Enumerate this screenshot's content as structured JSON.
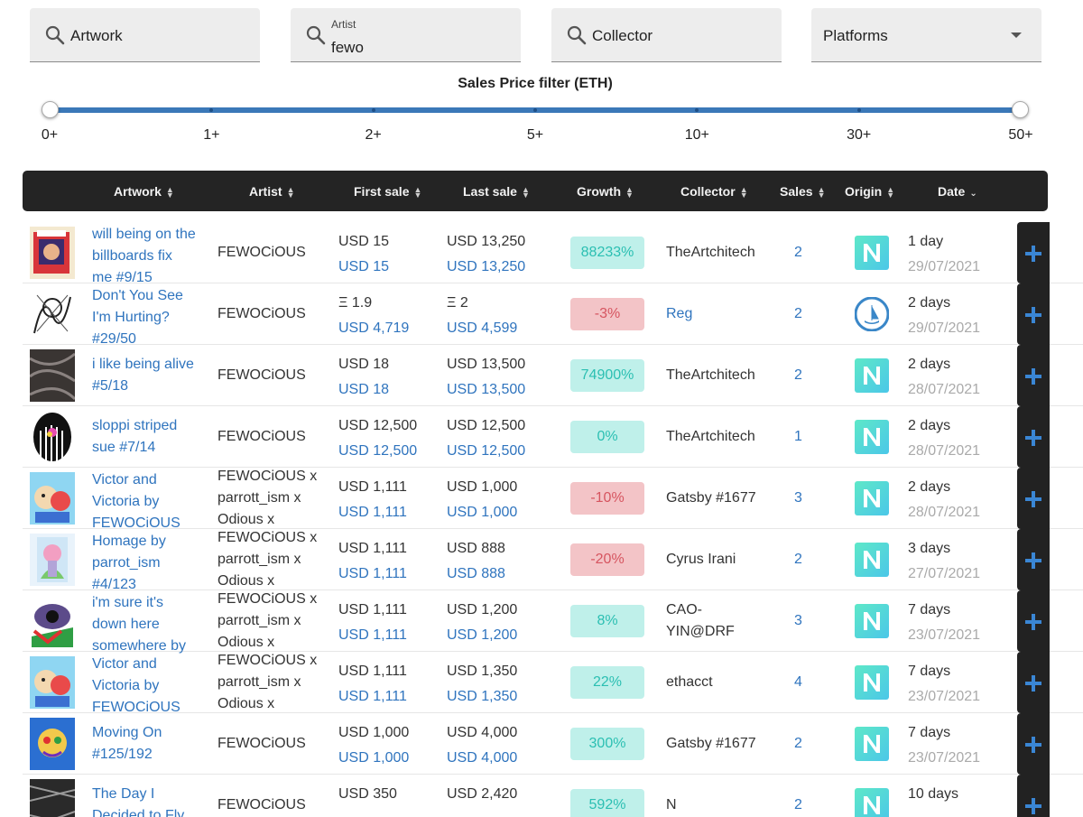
{
  "filters": {
    "artwork_placeholder": "Artwork",
    "artist_label": "Artist",
    "artist_value": "fewo",
    "collector_placeholder": "Collector",
    "platforms_placeholder": "Platforms"
  },
  "slider": {
    "title": "Sales Price filter (ETH)",
    "ticks": [
      "0+",
      "1+",
      "2+",
      "5+",
      "10+",
      "30+",
      "50+"
    ],
    "selected_min": "0+",
    "selected_max": "50+"
  },
  "columns": [
    "Artwork",
    "Artist",
    "First sale",
    "Last sale",
    "Growth",
    "Collector",
    "Sales",
    "Origin",
    "Date"
  ],
  "colors": {
    "accent": "#2f74be",
    "header_bg": "#242424",
    "growth_pos_bg": "#bff0ea",
    "growth_pos_text": "#2bbfb2",
    "growth_neg_bg": "#f3c4c7",
    "growth_neg_text": "#d65560",
    "nifty_origin": "#4fe0cc",
    "opensea_origin": "#2f74be"
  },
  "rows": [
    {
      "title": [
        "will being on the",
        "billboards fix",
        "me #9/15"
      ],
      "artist": [
        "FEWOCiOUS"
      ],
      "first_a": "USD 15",
      "first_b": "USD 15",
      "last_a": "USD 13,250",
      "last_b": "USD 13,250",
      "growth": "88233%",
      "growth_sign": "pos",
      "collector": "TheArtchitech",
      "collector_link": false,
      "sales": "2",
      "origin": "N",
      "origin_icon": "nifty-gateway-icon",
      "date_rel": "1 day",
      "date_abs": "29/07/2021"
    },
    {
      "title": [
        "Don't You See",
        "I'm Hurting?",
        "#29/50"
      ],
      "artist": [
        "FEWOCiOUS"
      ],
      "first_a": "Ξ 1.9",
      "first_b": "USD 4,719",
      "last_a": "Ξ 2",
      "last_b": "USD 4,599",
      "growth": "-3%",
      "growth_sign": "neg",
      "collector": "Reg",
      "collector_link": true,
      "sales": "2",
      "origin": "",
      "origin_icon": "opensea-icon",
      "date_rel": "2 days",
      "date_abs": "29/07/2021"
    },
    {
      "title": [
        "i like being alive",
        "#5/18"
      ],
      "artist": [
        "FEWOCiOUS"
      ],
      "first_a": "USD 18",
      "first_b": "USD 18",
      "last_a": "USD 13,500",
      "last_b": "USD 13,500",
      "growth": "74900%",
      "growth_sign": "pos",
      "collector": "TheArtchitech",
      "collector_link": false,
      "sales": "2",
      "origin": "N",
      "origin_icon": "nifty-gateway-icon",
      "date_rel": "2 days",
      "date_abs": "28/07/2021"
    },
    {
      "title": [
        "sloppi striped",
        "sue #7/14"
      ],
      "artist": [
        "FEWOCiOUS"
      ],
      "first_a": "USD 12,500",
      "first_b": "USD 12,500",
      "last_a": "USD 12,500",
      "last_b": "USD 12,500",
      "growth": "0%",
      "growth_sign": "pos",
      "collector": "TheArtchitech",
      "collector_link": false,
      "sales": "1",
      "origin": "N",
      "origin_icon": "nifty-gateway-icon",
      "date_rel": "2 days",
      "date_abs": "28/07/2021"
    },
    {
      "title": [
        "Victor and",
        "Victoria by",
        "FEWOCiOUS"
      ],
      "artist": [
        "FEWOCiOUS x",
        "parrott_ism x",
        "Odious x"
      ],
      "first_a": "USD 1,111",
      "first_b": "USD 1,111",
      "last_a": "USD 1,000",
      "last_b": "USD 1,000",
      "growth": "-10%",
      "growth_sign": "neg",
      "collector": "Gatsby #1677",
      "collector_link": false,
      "sales": "3",
      "origin": "N",
      "origin_icon": "nifty-gateway-icon",
      "date_rel": "2 days",
      "date_abs": "28/07/2021"
    },
    {
      "title": [
        "Homage by",
        "parrot_ism",
        "#4/123"
      ],
      "artist": [
        "FEWOCiOUS x",
        "parrott_ism x",
        "Odious x"
      ],
      "first_a": "USD 1,111",
      "first_b": "USD 1,111",
      "last_a": "USD 888",
      "last_b": "USD 888",
      "growth": "-20%",
      "growth_sign": "neg",
      "collector": "Cyrus Irani",
      "collector_link": false,
      "sales": "2",
      "origin": "N",
      "origin_icon": "nifty-gateway-icon",
      "date_rel": "3 days",
      "date_abs": "27/07/2021"
    },
    {
      "title": [
        "i'm sure it's",
        "down here",
        "somewhere by"
      ],
      "artist": [
        "FEWOCiOUS x",
        "parrott_ism x",
        "Odious x"
      ],
      "first_a": "USD 1,111",
      "first_b": "USD 1,111",
      "last_a": "USD 1,200",
      "last_b": "USD 1,200",
      "growth": "8%",
      "growth_sign": "pos",
      "collector": "CAO-\nYIN@DRF",
      "collector_link": false,
      "sales": "3",
      "origin": "N",
      "origin_icon": "nifty-gateway-icon",
      "date_rel": "7 days",
      "date_abs": "23/07/2021"
    },
    {
      "title": [
        "Victor and",
        "Victoria by",
        "FEWOCiOUS"
      ],
      "artist": [
        "FEWOCiOUS x",
        "parrott_ism x",
        "Odious x"
      ],
      "first_a": "USD 1,111",
      "first_b": "USD 1,111",
      "last_a": "USD 1,350",
      "last_b": "USD 1,350",
      "growth": "22%",
      "growth_sign": "pos",
      "collector": "ethacct",
      "collector_link": false,
      "sales": "4",
      "origin": "N",
      "origin_icon": "nifty-gateway-icon",
      "date_rel": "7 days",
      "date_abs": "23/07/2021"
    },
    {
      "title": [
        "Moving On",
        "#125/192"
      ],
      "artist": [
        "FEWOCiOUS"
      ],
      "first_a": "USD 1,000",
      "first_b": "USD 1,000",
      "last_a": "USD 4,000",
      "last_b": "USD 4,000",
      "growth": "300%",
      "growth_sign": "pos",
      "collector": "Gatsby #1677",
      "collector_link": false,
      "sales": "2",
      "origin": "N",
      "origin_icon": "nifty-gateway-icon",
      "date_rel": "7 days",
      "date_abs": "23/07/2021"
    },
    {
      "title": [
        "The Day I",
        "Decided to Fly"
      ],
      "artist": [
        "FEWOCiOUS"
      ],
      "first_a": "USD 350",
      "first_b": "",
      "last_a": "USD 2,420",
      "last_b": "",
      "growth": "592%",
      "growth_sign": "pos",
      "collector": "N",
      "collector_link": false,
      "sales": "2",
      "origin": "N",
      "origin_icon": "nifty-gateway-icon",
      "date_rel": "10 days",
      "date_abs": ""
    }
  ]
}
